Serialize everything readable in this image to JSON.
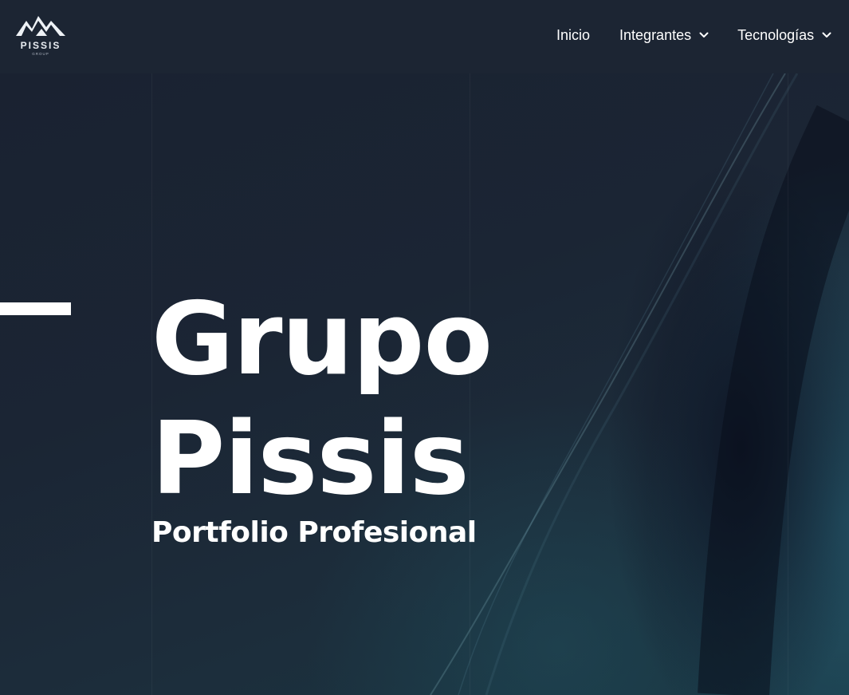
{
  "header": {
    "logo": {
      "name": "PISSIS",
      "tagline": "GROUP",
      "icon": "mountains-icon"
    },
    "nav": [
      {
        "label": "Inicio",
        "has_dropdown": false
      },
      {
        "label": "Integrantes",
        "has_dropdown": true,
        "icon": "chevron-down-icon"
      },
      {
        "label": "Tecnologías",
        "has_dropdown": true,
        "icon": "chevron-down-icon"
      }
    ]
  },
  "hero": {
    "title_line1": "Grupo",
    "title_line2": "Pissis",
    "subtitle": "Portfolio Profesional"
  },
  "colors": {
    "header_bg": "#1c2533",
    "hero_bg_dark": "#1a2231",
    "hero_bg_teal": "#265c70",
    "text": "#ffffff"
  }
}
